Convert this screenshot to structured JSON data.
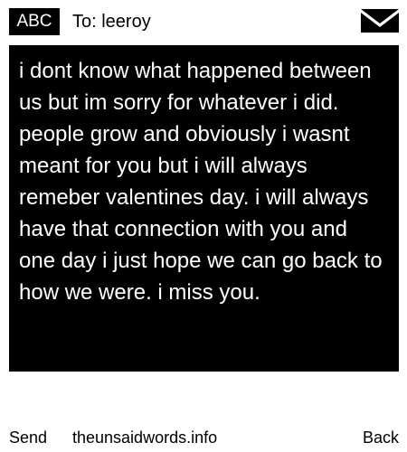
{
  "header": {
    "input_mode": "ABC",
    "recipient": "To: leeroy",
    "icon": "envelope-icon"
  },
  "message": {
    "text": "i dont know what happened between us but im sorry for whatever i did. people grow and obviously i wasnt meant for you but i will always remeber valentines day. i will always have that connection with you and one day i just hope we can go back to how we were. i miss you."
  },
  "softkeys": {
    "left_label": "Send",
    "center_label": "theunsaidwords.info",
    "right_label": "Back"
  },
  "colors": {
    "background": "#ffffff",
    "message_box": "#000000",
    "text": "#000000",
    "message_text": "#ffffff"
  }
}
